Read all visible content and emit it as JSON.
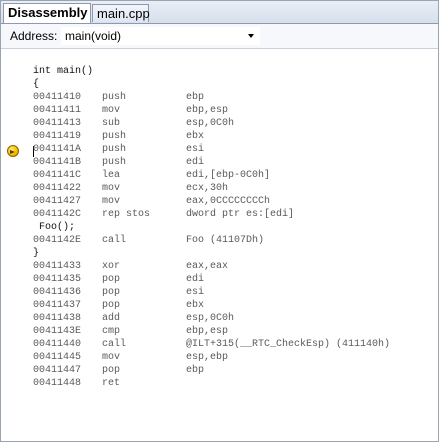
{
  "tabs": [
    {
      "label": "Disassembly",
      "active": true
    },
    {
      "label": "main.cpp",
      "active": false
    }
  ],
  "address": {
    "label": "Address:",
    "value": "main(void)"
  },
  "code": [
    {
      "kind": "src",
      "text": "int main()"
    },
    {
      "kind": "src",
      "text": "{"
    },
    {
      "kind": "asm",
      "addr": "00411410",
      "mnemonic": "push",
      "operands": "ebp",
      "current": true
    },
    {
      "kind": "asm",
      "addr": "00411411",
      "mnemonic": "mov",
      "operands": "ebp,esp"
    },
    {
      "kind": "asm",
      "addr": "00411413",
      "mnemonic": "sub",
      "operands": "esp,0C0h"
    },
    {
      "kind": "asm",
      "addr": "00411419",
      "mnemonic": "push",
      "operands": "ebx"
    },
    {
      "kind": "asm",
      "addr": "0041141A",
      "mnemonic": "push",
      "operands": "esi"
    },
    {
      "kind": "asm",
      "addr": "0041141B",
      "mnemonic": "push",
      "operands": "edi"
    },
    {
      "kind": "asm",
      "addr": "0041141C",
      "mnemonic": "lea",
      "operands": "edi,[ebp-0C0h]"
    },
    {
      "kind": "asm",
      "addr": "00411422",
      "mnemonic": "mov",
      "operands": "ecx,30h"
    },
    {
      "kind": "asm",
      "addr": "00411427",
      "mnemonic": "mov",
      "operands": "eax,0CCCCCCCCh"
    },
    {
      "kind": "asm",
      "addr": "0041142C",
      "mnemonic": "rep stos",
      "operands": "dword ptr es:[edi]"
    },
    {
      "kind": "src",
      "text": "Foo();",
      "indent": true
    },
    {
      "kind": "asm",
      "addr": "0041142E",
      "mnemonic": "call",
      "operands": "Foo (41107Dh)"
    },
    {
      "kind": "src",
      "text": "}"
    },
    {
      "kind": "asm",
      "addr": "00411433",
      "mnemonic": "xor",
      "operands": "eax,eax"
    },
    {
      "kind": "asm",
      "addr": "00411435",
      "mnemonic": "pop",
      "operands": "edi"
    },
    {
      "kind": "asm",
      "addr": "00411436",
      "mnemonic": "pop",
      "operands": "esi"
    },
    {
      "kind": "asm",
      "addr": "00411437",
      "mnemonic": "pop",
      "operands": "ebx"
    },
    {
      "kind": "asm",
      "addr": "00411438",
      "mnemonic": "add",
      "operands": "esp,0C0h"
    },
    {
      "kind": "asm",
      "addr": "0041143E",
      "mnemonic": "cmp",
      "operands": "ebp,esp"
    },
    {
      "kind": "asm",
      "addr": "00411440",
      "mnemonic": "call",
      "operands": "@ILT+315(__RTC_CheckEsp) (411140h)"
    },
    {
      "kind": "asm",
      "addr": "00411445",
      "mnemonic": "mov",
      "operands": "esp,ebp"
    },
    {
      "kind": "asm",
      "addr": "00411447",
      "mnemonic": "pop",
      "operands": "ebp"
    },
    {
      "kind": "asm",
      "addr": "00411448",
      "mnemonic": "ret",
      "operands": ""
    }
  ],
  "icons": {
    "current_instruction": "instruction-pointer-arrow-icon"
  }
}
